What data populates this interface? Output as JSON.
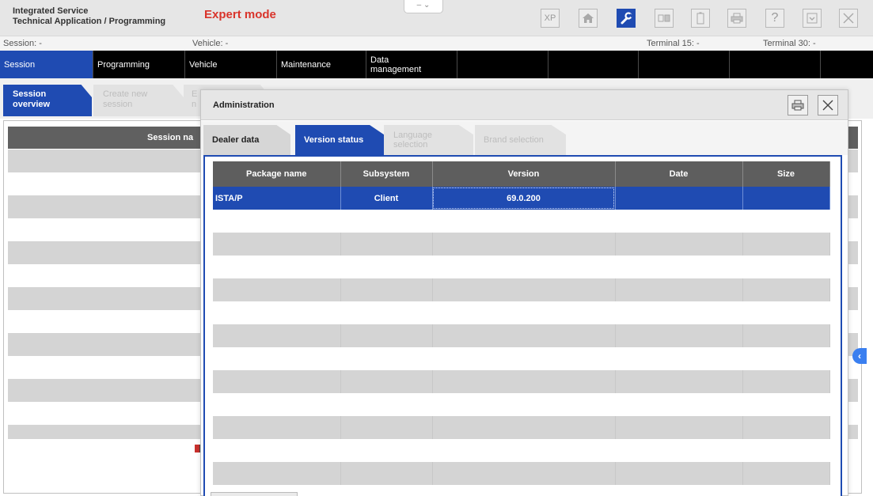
{
  "app": {
    "title_line1": "Integrated Service",
    "title_line2": "Technical Application / Programming",
    "mode": "Expert mode",
    "dropdown_glyph": "– ⌄"
  },
  "toolbar": {
    "buttons": [
      {
        "name": "xp-button",
        "label": "XP"
      },
      {
        "name": "home-button",
        "icon": "home-icon"
      },
      {
        "name": "wrench-button",
        "icon": "wrench-icon",
        "active": true
      },
      {
        "name": "display-button",
        "icon": "display-icon"
      },
      {
        "name": "battery-button",
        "icon": "battery-icon"
      },
      {
        "name": "print-button",
        "icon": "printer-icon"
      },
      {
        "name": "help-button",
        "label": "?"
      },
      {
        "name": "minimize-button",
        "icon": "minimize-icon"
      },
      {
        "name": "close-button",
        "icon": "close-icon"
      }
    ]
  },
  "infobar": {
    "session": "Session:  -",
    "vehicle": "Vehicle:  -",
    "terminal15": "Terminal 15:  -",
    "terminal30": "Terminal 30:  -"
  },
  "nav": {
    "session": "Session",
    "programming": "Programming",
    "vehicle": "Vehicle",
    "maintenance": "Maintenance",
    "data_line1": "Data",
    "data_line2": "management"
  },
  "subtabs": {
    "overview_line1": "Session",
    "overview_line2": "overview",
    "create_line1": "Create new",
    "create_line2": "session",
    "third_line1": "E",
    "third_line2": "n"
  },
  "session_table": {
    "header": "Session na"
  },
  "side_arrow": "‹",
  "modal": {
    "title": "Administration",
    "tabs": {
      "dealer": "Dealer data",
      "version": "Version status",
      "language_line1": "Language",
      "language_line2": "selection",
      "brand": "Brand selection"
    },
    "table": {
      "columns": [
        "Package name",
        "Subsystem",
        "Version",
        "Date",
        "Size"
      ],
      "rows": [
        {
          "package": "ISTA/P",
          "subsystem": "Client",
          "version": "69.0.200",
          "date": "",
          "size": ""
        }
      ]
    }
  },
  "colors": {
    "accent_blue": "#1f4bb2",
    "expert_red": "#d9342b",
    "header_grey": "#5e5e5e"
  }
}
